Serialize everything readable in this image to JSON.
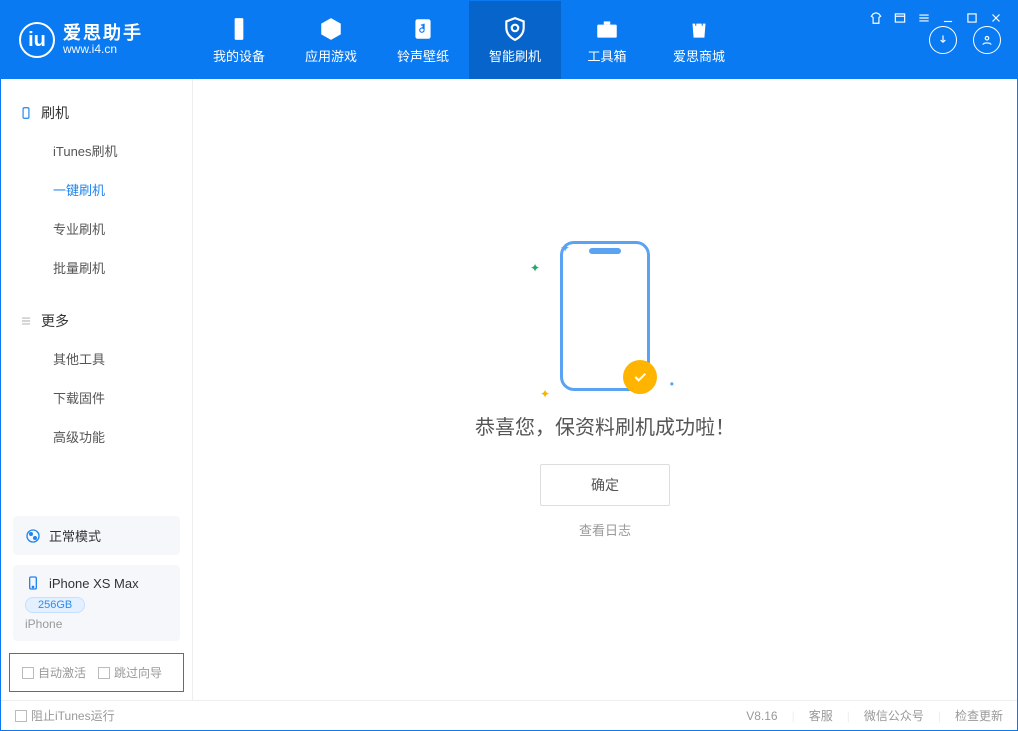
{
  "brand": {
    "name": "爱思助手",
    "domain": "www.i4.cn"
  },
  "nav": [
    {
      "label": "我的设备",
      "icon": "device"
    },
    {
      "label": "应用游戏",
      "icon": "cube"
    },
    {
      "label": "铃声壁纸",
      "icon": "music"
    },
    {
      "label": "智能刷机",
      "icon": "shield",
      "active": true
    },
    {
      "label": "工具箱",
      "icon": "toolbox"
    },
    {
      "label": "爱思商城",
      "icon": "shop"
    }
  ],
  "sidebar": {
    "section1": {
      "title": "刷机",
      "items": [
        "iTunes刷机",
        "一键刷机",
        "专业刷机",
        "批量刷机"
      ],
      "activeIndex": 1
    },
    "section2": {
      "title": "更多",
      "items": [
        "其他工具",
        "下载固件",
        "高级功能"
      ]
    }
  },
  "status": {
    "mode": "正常模式"
  },
  "device": {
    "name": "iPhone XS Max",
    "capacity": "256GB",
    "type": "iPhone"
  },
  "options": {
    "autoActivate": "自动激活",
    "skipGuide": "跳过向导"
  },
  "main": {
    "successText": "恭喜您，保资料刷机成功啦！",
    "okButton": "确定",
    "viewLog": "查看日志"
  },
  "footer": {
    "blockItunes": "阻止iTunes运行",
    "version": "V8.16",
    "links": [
      "客服",
      "微信公众号",
      "检查更新"
    ]
  }
}
